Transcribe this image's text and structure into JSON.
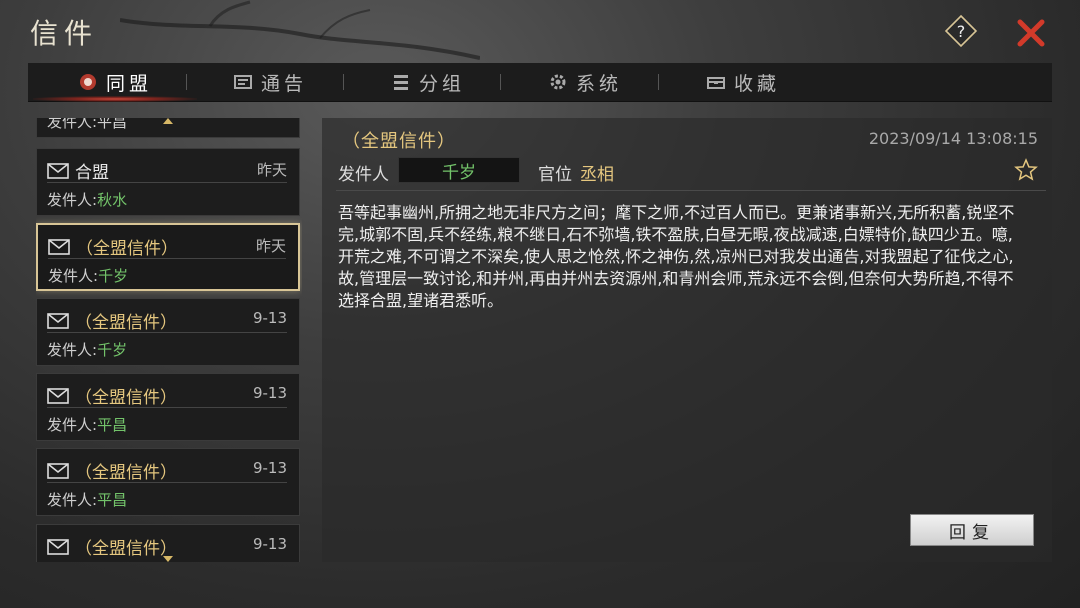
{
  "window": {
    "title": "信件"
  },
  "tabs": [
    {
      "label": "同盟",
      "icon": "alliance-emblem-icon",
      "active": true
    },
    {
      "label": "通告",
      "icon": "notice-icon",
      "active": false
    },
    {
      "label": "分组",
      "icon": "group-list-icon",
      "active": false
    },
    {
      "label": "系统",
      "icon": "gear-icon",
      "active": false
    },
    {
      "label": "收藏",
      "icon": "chest-icon",
      "active": false
    }
  ],
  "mail_list": {
    "partial_top_sender": "发件人:平昌",
    "items": [
      {
        "subject": "合盟",
        "date": "昨天",
        "sender_label": "发件人:",
        "sender": "秋水",
        "selected": false
      },
      {
        "subject": "（全盟信件）",
        "date": "昨天",
        "sender_label": "发件人:",
        "sender": "千岁",
        "selected": true
      },
      {
        "subject": "（全盟信件）",
        "date": "9-13",
        "sender_label": "发件人:",
        "sender": "千岁",
        "selected": false
      },
      {
        "subject": "（全盟信件）",
        "date": "9-13",
        "sender_label": "发件人:",
        "sender": "平昌",
        "selected": false
      },
      {
        "subject": "（全盟信件）",
        "date": "9-13",
        "sender_label": "发件人:",
        "sender": "平昌",
        "selected": false
      },
      {
        "subject": "（全盟信件）",
        "date": "9-13",
        "sender_label": "",
        "sender": "",
        "selected": false
      }
    ]
  },
  "mail": {
    "subject": "（全盟信件）",
    "timestamp": "2023/09/14 13:08:15",
    "from_label": "发件人",
    "from": "千岁",
    "rank_label": "官位",
    "rank": "丞相",
    "body": "吾等起事幽州,所拥之地无非尺方之间；麾下之师,不过百人而已。更兼诸事新兴,无所积蓄,锐坚不完,城郭不固,兵不经练,粮不继日,石不弥墙,铁不盈肤,白昼无暇,夜战减速,白嫖特价,缺四少五。噫,开荒之难,不可谓之不深矣,使人思之怆然,怀之神伤,然,凉州已对我发出通告,对我盟起了征伐之心,故,管理层一致讨论,和并州,再由并州去资源州,和青州会师,荒永远不会倒,但奈何大势所趋,不得不选择合盟,望诸君悉听。",
    "reply_label": "回复"
  },
  "colors": {
    "accent_gold": "#e5c77f",
    "sender_green": "#73c36a",
    "close_red": "#d23a2a",
    "tab_active_glow": "#c8483b"
  }
}
